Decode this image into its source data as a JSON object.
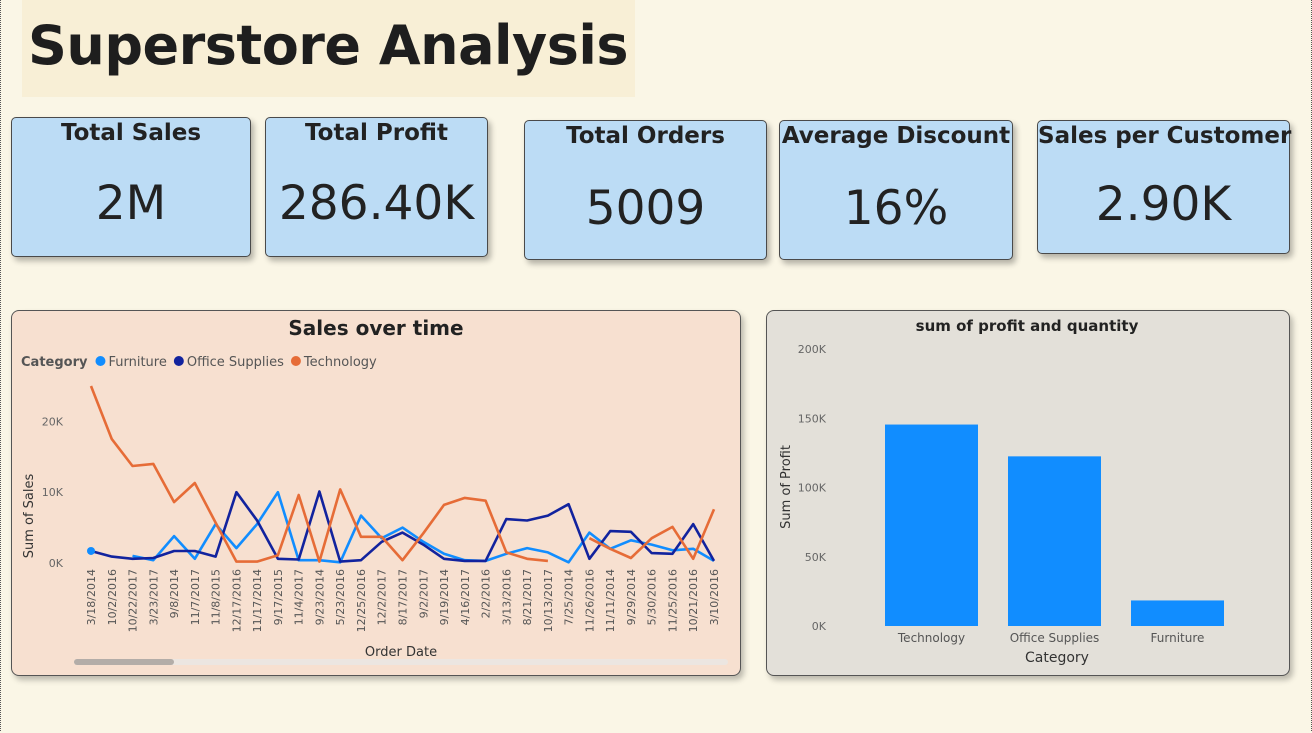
{
  "header": {
    "title": "Superstore Analysis"
  },
  "kpis": [
    {
      "label": "Total Sales",
      "value": "2M"
    },
    {
      "label": "Total Profit",
      "value": "286.40K"
    },
    {
      "label": "Total Orders",
      "value": "5009"
    },
    {
      "label": "Average Discount",
      "value": "16%"
    },
    {
      "label": "Sales per Customer",
      "value": "2.90K"
    }
  ],
  "colors": {
    "furniture": "#118dff",
    "office_supplies": "#12239e",
    "technology": "#e66c37",
    "bar": "#118dff",
    "card": "#bcdcf5"
  },
  "chart_data": [
    {
      "type": "line",
      "title": "Sales over time",
      "legend_title": "Category",
      "legend_position": "top-left",
      "xlabel": "Order Date",
      "ylabel": "Sum of Sales",
      "yticks": [
        "0K",
        "10K",
        "20K"
      ],
      "ylim": [
        0,
        25000
      ],
      "x": [
        "3/18/2014",
        "10/2/2016",
        "10/22/2017",
        "3/23/2017",
        "9/8/2014",
        "11/7/2017",
        "11/8/2015",
        "12/17/2016",
        "11/17/2014",
        "9/17/2015",
        "11/4/2017",
        "9/23/2014",
        "5/23/2016",
        "12/25/2016",
        "12/2/2017",
        "8/17/2017",
        "9/2/2017",
        "9/19/2014",
        "4/16/2017",
        "2/2/2016",
        "3/13/2016",
        "8/21/2017",
        "10/13/2017",
        "7/25/2014",
        "11/26/2016",
        "11/11/2014",
        "9/29/2014",
        "5/30/2016",
        "11/25/2016",
        "10/21/2016",
        "3/10/2016"
      ],
      "series": [
        {
          "name": "Furniture",
          "values": [
            null,
            null,
            1000,
            400,
            3800,
            600,
            5500,
            2100,
            5500,
            10000,
            400,
            400,
            100,
            6700,
            3500,
            5000,
            3000,
            1300,
            400,
            300,
            1300,
            2100,
            1500,
            100,
            4300,
            2000,
            3200,
            2600,
            1800,
            2000,
            300
          ]
        },
        {
          "name": "Office Supplies",
          "values": [
            1700,
            900,
            600,
            700,
            1700,
            1700,
            900,
            10000,
            6000,
            600,
            500,
            10100,
            200,
            400,
            3000,
            4300,
            2600,
            600,
            300,
            300,
            6200,
            6000,
            6700,
            8300,
            600,
            4500,
            4400,
            1400,
            1300,
            5500,
            300
          ]
        },
        {
          "name": "Technology",
          "values": [
            25000,
            17500,
            13700,
            14000,
            8600,
            11300,
            5700,
            200,
            200,
            1100,
            9600,
            200,
            10400,
            3700,
            3700,
            400,
            4200,
            8200,
            9200,
            8800,
            1500,
            600,
            300,
            null,
            3500,
            2000,
            700,
            3500,
            5100,
            600,
            7600
          ]
        }
      ]
    },
    {
      "type": "bar",
      "title": "sum of profit and quantity",
      "xlabel": "Category",
      "ylabel": "Sum of Profit",
      "yticks": [
        "0K",
        "50K",
        "100K",
        "150K",
        "200K"
      ],
      "ylim": [
        0,
        200000
      ],
      "categories": [
        "Technology",
        "Office Supplies",
        "Furniture"
      ],
      "values": [
        145455,
        122491,
        18451
      ]
    }
  ]
}
